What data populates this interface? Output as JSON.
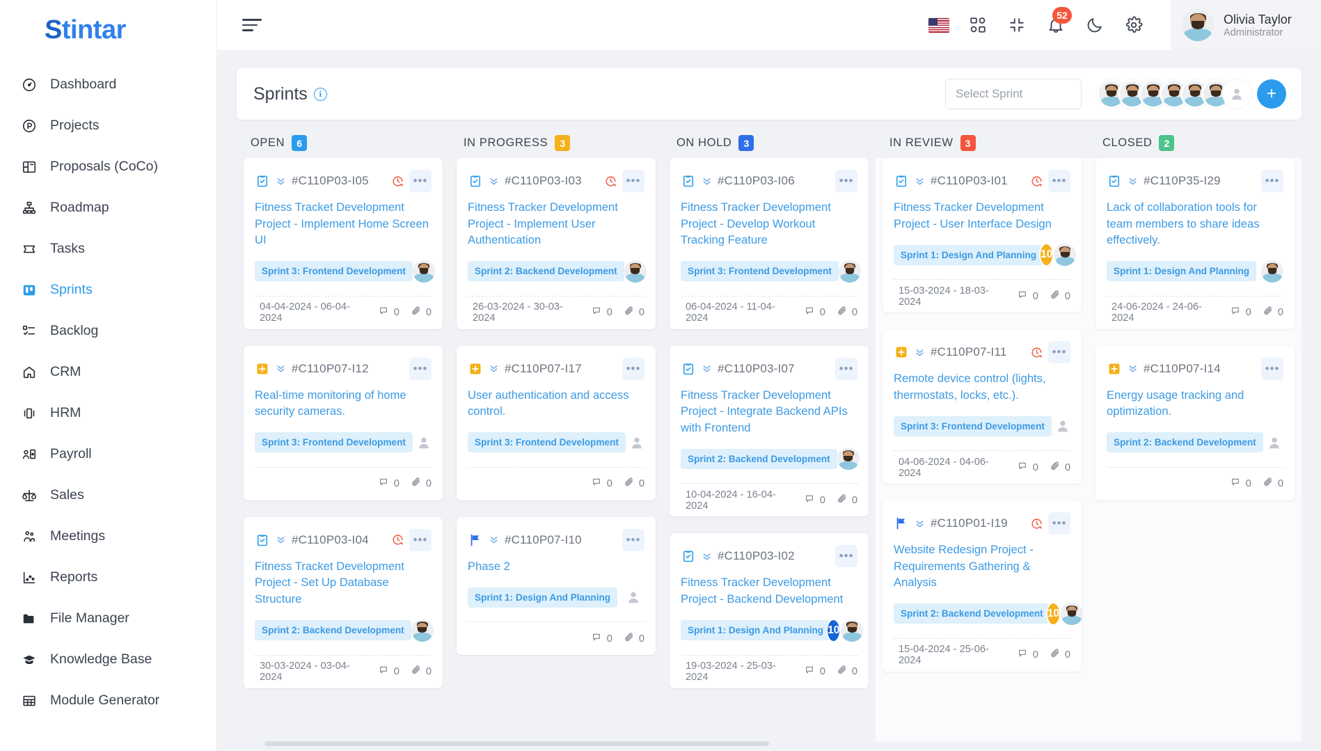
{
  "brand": {
    "mark": "S",
    "rest": "tintar"
  },
  "sidebar": {
    "items": [
      {
        "label": "Dashboard",
        "icon": "gauge-icon",
        "active": false,
        "chevron": false
      },
      {
        "label": "Projects",
        "icon": "projects-icon",
        "active": false,
        "chevron": false
      },
      {
        "label": "Proposals (CoCo)",
        "icon": "proposals-icon",
        "active": false,
        "chevron": false
      },
      {
        "label": "Roadmap",
        "icon": "roadmap-icon",
        "active": false,
        "chevron": false
      },
      {
        "label": "Tasks",
        "icon": "tasks-icon",
        "active": false,
        "chevron": false
      },
      {
        "label": "Sprints",
        "icon": "sprints-icon",
        "active": true,
        "chevron": false
      },
      {
        "label": "Backlog",
        "icon": "backlog-icon",
        "active": false,
        "chevron": false
      },
      {
        "label": "CRM",
        "icon": "crm-icon",
        "active": false,
        "chevron": true
      },
      {
        "label": "HRM",
        "icon": "hrm-icon",
        "active": false,
        "chevron": true
      },
      {
        "label": "Payroll",
        "icon": "payroll-icon",
        "active": false,
        "chevron": true
      },
      {
        "label": "Sales",
        "icon": "sales-icon",
        "active": false,
        "chevron": true
      },
      {
        "label": "Meetings",
        "icon": "meetings-icon",
        "active": false,
        "chevron": false
      },
      {
        "label": "Reports",
        "icon": "reports-icon",
        "active": false,
        "chevron": false
      },
      {
        "label": "File Manager",
        "icon": "folder-icon",
        "active": false,
        "chevron": false
      },
      {
        "label": "Knowledge Base",
        "icon": "graduation-cap-icon",
        "active": false,
        "chevron": false
      },
      {
        "label": "Module Generator",
        "icon": "grid-table-icon",
        "active": false,
        "chevron": false
      }
    ]
  },
  "topbar": {
    "menu_icon": "hamburger-icon",
    "icons": [
      {
        "name": "flag-us-icon"
      },
      {
        "name": "apps-grid-icon"
      },
      {
        "name": "collapse-icon"
      },
      {
        "name": "bell-icon",
        "badge": "52"
      },
      {
        "name": "moon-icon"
      },
      {
        "name": "gear-icon"
      }
    ],
    "user": {
      "name": "Olivia Taylor",
      "role": "Administrator"
    }
  },
  "sprint_bar": {
    "title": "Sprints",
    "info_icon": "info-icon",
    "select_placeholder": "Select Sprint",
    "avatar_count": 6,
    "anon_avatar": true,
    "add_label": "+"
  },
  "board": {
    "columns": [
      {
        "name": "OPEN",
        "count": "6",
        "count_color": "#2b9ced",
        "shaded": false,
        "cards": [
          {
            "type_icon": "clipboard-check-icon",
            "id": "#C110P03-I05",
            "overdue": true,
            "title": "Fitness Tracket Development Project - Implement Home Screen UI",
            "sprint": "Sprint 3: Frontend Development",
            "points": null,
            "assignee": "photo",
            "date": "04-04-2024 - 06-04-2024",
            "comments": "0",
            "attachments": "0"
          },
          {
            "type_icon": "plus-square-icon",
            "id": "#C110P07-I12",
            "overdue": false,
            "title": "Real-time monitoring of home security cameras.",
            "sprint": "Sprint 3: Frontend Development",
            "points": null,
            "assignee": "anon",
            "date": null,
            "comments": "0",
            "attachments": "0"
          },
          {
            "type_icon": "clipboard-check-icon",
            "id": "#C110P03-I04",
            "overdue": true,
            "title": "Fitness Tracket Development Project - Set Up Database Structure",
            "sprint": "Sprint 2: Backend Development",
            "points": null,
            "assignee": "photo",
            "date": "30-03-2024 - 03-04-2024",
            "comments": "0",
            "attachments": "0"
          }
        ]
      },
      {
        "name": "IN PROGRESS",
        "count": "3",
        "count_color": "#f5b01a",
        "shaded": false,
        "cards": [
          {
            "type_icon": "clipboard-check-icon",
            "id": "#C110P03-I03",
            "overdue": true,
            "title": "Fitness Tracker Development Project - Implement User Authentication",
            "sprint": "Sprint 2: Backend Development",
            "points": null,
            "assignee": "photo",
            "date": "26-03-2024 - 30-03-2024",
            "comments": "0",
            "attachments": "0"
          },
          {
            "type_icon": "plus-square-icon",
            "id": "#C110P07-I17",
            "overdue": false,
            "title": "User authentication and access control.",
            "sprint": "Sprint 3: Frontend Development",
            "points": null,
            "assignee": "anon",
            "date": null,
            "comments": "0",
            "attachments": "0"
          },
          {
            "type_icon": "flag-icon",
            "id": "#C110P07-I10",
            "overdue": false,
            "title": "Phase 2",
            "sprint": "Sprint 1: Design And Planning",
            "points": null,
            "assignee": "anon",
            "date": null,
            "comments": "0",
            "attachments": "0"
          }
        ]
      },
      {
        "name": "ON HOLD",
        "count": "3",
        "count_color": "#2f6fe8",
        "shaded": false,
        "cards": [
          {
            "type_icon": "clipboard-check-icon",
            "id": "#C110P03-I06",
            "overdue": false,
            "title": "Fitness Tracker Development Project - Develop Workout Tracking Feature",
            "sprint": "Sprint 3: Frontend Development",
            "points": null,
            "assignee": "photo",
            "date": "06-04-2024 - 11-04-2024",
            "comments": "0",
            "attachments": "0"
          },
          {
            "type_icon": "clipboard-check-icon",
            "id": "#C110P03-I07",
            "overdue": false,
            "title": "Fitness Tracker Development Project - Integrate Backend APIs with Frontend",
            "sprint": "Sprint 2: Backend Development",
            "points": null,
            "assignee": "photo",
            "date": "10-04-2024 - 16-04-2024",
            "comments": "0",
            "attachments": "0"
          },
          {
            "type_icon": "clipboard-check-icon",
            "id": "#C110P03-I02",
            "overdue": false,
            "title": "Fitness Tracker Development Project - Backend Development",
            "sprint": "Sprint 1: Design And Planning",
            "points": "10",
            "points_color": "#1565d8",
            "assignee": "photo",
            "date": "19-03-2024 - 25-03-2024",
            "comments": "0",
            "attachments": "0"
          }
        ]
      },
      {
        "name": "IN REVIEW",
        "count": "3",
        "count_color": "#f4553d",
        "shaded": true,
        "cards": [
          {
            "type_icon": "clipboard-check-icon",
            "id": "#C110P03-I01",
            "overdue": true,
            "title": "Fitness Tracker Development Project - User Interface Design",
            "sprint": "Sprint 1: Design And Planning",
            "points": "10",
            "points_color": "#f5b01a",
            "assignee": "photo",
            "date": "15-03-2024 - 18-03-2024",
            "comments": "0",
            "attachments": "0"
          },
          {
            "type_icon": "plus-square-icon",
            "id": "#C110P07-I11",
            "overdue": true,
            "title": "Remote device control (lights, thermostats, locks, etc.).",
            "sprint": "Sprint 3: Frontend Development",
            "points": null,
            "assignee": "anon",
            "date": "04-06-2024 - 04-06-2024",
            "comments": "0",
            "attachments": "0"
          },
          {
            "type_icon": "flag-icon",
            "id": "#C110P01-I19",
            "overdue": true,
            "title": "Website Redesign Project - Requirements Gathering & Analysis",
            "sprint": "Sprint 2: Backend Development",
            "points": "10",
            "points_color": "#f5b01a",
            "assignee": "photo",
            "date": "15-04-2024 - 25-06-2024",
            "comments": "0",
            "attachments": "0"
          }
        ]
      },
      {
        "name": "CLOSED",
        "count": "2",
        "count_color": "#4cc38a",
        "shaded": true,
        "cards": [
          {
            "type_icon": "clipboard-check-icon",
            "id": "#C110P35-I29",
            "overdue": false,
            "title": "Lack of collaboration tools for team members to share ideas effectively.",
            "sprint": "Sprint 1: Design And Planning",
            "points": null,
            "assignee": "photo",
            "date": "24-06-2024 - 24-06-2024",
            "comments": "0",
            "attachments": "0"
          },
          {
            "type_icon": "plus-square-icon",
            "id": "#C110P07-I14",
            "overdue": false,
            "title": "Energy usage tracking and optimization.",
            "sprint": "Sprint 2: Backend Development",
            "points": null,
            "assignee": "anon",
            "date": null,
            "comments": "0",
            "attachments": "0"
          }
        ]
      }
    ]
  }
}
